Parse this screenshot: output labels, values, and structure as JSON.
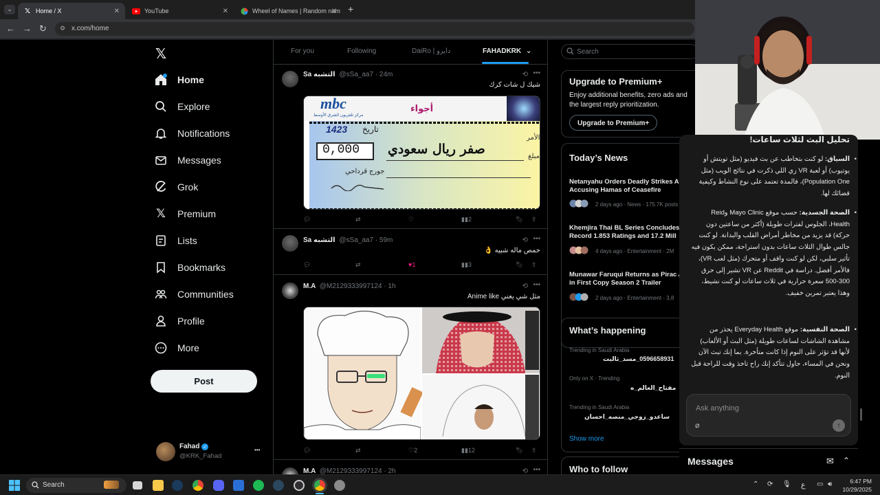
{
  "browser": {
    "tabs": [
      {
        "title": "Home / X"
      },
      {
        "title": "YouTube"
      },
      {
        "title": "Wheel of Names | Random nam"
      }
    ],
    "new_tab": "+",
    "url": "x.com/home"
  },
  "sidebar": {
    "items": [
      {
        "label": "Home",
        "icon": "home-icon"
      },
      {
        "label": "Explore",
        "icon": "search-icon"
      },
      {
        "label": "Notifications",
        "icon": "bell-icon"
      },
      {
        "label": "Messages",
        "icon": "mail-icon"
      },
      {
        "label": "Grok",
        "icon": "grok-icon"
      },
      {
        "label": "Premium",
        "icon": "x-logo-icon"
      },
      {
        "label": "Lists",
        "icon": "list-icon"
      },
      {
        "label": "Bookmarks",
        "icon": "bookmark-icon"
      },
      {
        "label": "Communities",
        "icon": "communities-icon"
      },
      {
        "label": "Profile",
        "icon": "person-icon"
      },
      {
        "label": "More",
        "icon": "more-circle-icon"
      }
    ],
    "post_label": "Post",
    "account": {
      "name": "Fahad",
      "handle": "@KRK_Fahad",
      "more": "•••"
    }
  },
  "timeline": {
    "tabs": [
      {
        "label": "For you"
      },
      {
        "label": "Following"
      },
      {
        "label": "DaiRo | دايرو"
      },
      {
        "label": "FAHADKRK"
      }
    ],
    "tweets": [
      {
        "name": "Sa التشبه",
        "handle": "@sSa_aa7 · 24m",
        "text": "شيك ل شات كرك",
        "media": {
          "brand": "mbc",
          "brand_sub": "مركز تلفزيون الشرق الأوسط",
          "ajwa": "أجواء",
          "date_label": "تاريخ",
          "date": "1423",
          "amount": "0,000",
          "words": "صفر ريال سعودي",
          "signer": "جورج قرداحي",
          "order_label": "الأمر",
          "amount_label": "مبلغ"
        },
        "replies": "",
        "retweets": "",
        "likes": "",
        "views": "2"
      },
      {
        "name": "Sa التشبه",
        "handle": "@sSa_aa7 · 59m",
        "text": "حمص ماله شبيه 👌",
        "replies": "",
        "retweets": "",
        "likes": "1",
        "views": "3"
      },
      {
        "name": "M.A",
        "handle": "@M2129333997124 · 1h",
        "text": "مثل شي يعني Anime like",
        "replies": "",
        "retweets": "",
        "likes": "2",
        "views": "12"
      },
      {
        "name": "M.A",
        "handle": "@M2129333997124 · 2h",
        "text": ""
      }
    ]
  },
  "right": {
    "search_placeholder": "Search",
    "premium": {
      "title": "Upgrade to Premium+",
      "desc": "Enjoy additional benefits, zero ads and the largest reply prioritization.",
      "button": "Upgrade to Premium+"
    },
    "news": {
      "title": "Today’s News",
      "items": [
        {
          "title": "Netanyahu Orders Deadly Strikes After Accusing Hamas of Ceasefire",
          "meta": "2 days ago · News · 175.7K posts"
        },
        {
          "title": "Khemjira Thai BL Series Concludes Record 1.853 Ratings and 17.2 Mill",
          "meta": "4 days ago · Entertainment · 2M"
        },
        {
          "title": "Munawar Faruqui Returns as Pirac Arif in First Copy Season 2 Trailer",
          "meta": "2 days ago · Entertainment · 3,8"
        }
      ]
    },
    "happening": {
      "title": "What’s happening",
      "items": [
        {
          "category": "Trending in Saudi Arabia",
          "name": "0596658931_مسد_ثالبت"
        },
        {
          "category": "Only on X · Trending",
          "name": "مفتاح_العالم_ه"
        },
        {
          "category": "Trending in Saudi Arabia",
          "name": "ساعدو_زوجي_منصه_احسان"
        }
      ],
      "show_more": "Show more"
    },
    "who_to_follow": "Who to follow"
  },
  "chat": {
    "heading": "تحليل البث لثلاث ساعات!",
    "bullets": [
      {
        "label": "السياق:",
        "text": "لو كنت بتخاطب عن بث فيديو (مثل تويتش أو يوتيوب) أو لعبة VR زي اللي ذكرت في نتائج الويب (مثل Population One)، فالمدة تعتمد على نوع النشاط وكيفية قضائك لها."
      },
      {
        "label": "الصحة الجسدية:",
        "text": "حسب موقع Mayo Clinic وReid Health، الجلوس لفترات طويلة (أكثر من ساعتين دون حركة) قد يزيد من مخاطر أمراض القلب والبدانة. لو كنت جالس طوال الثلاث ساعات بدون استراحة، ممكن يكون فيه تأثير سلبي، لكن لو كنت واقف أو متحرك (مثل لعب VR)، فالأمر أفضل. دراسة في Reddit عن VR تشير إلى حرق 300-500 سعرة حرارية في ثلاث ساعات لو كنت نشيط، وهذا يعتبر تمرين خفيف."
      },
      {
        "label": "الصحة النفسية:",
        "text": "موقع Everyday Health يحذر من مشاهدة الشاشات لساعات طويلة (مثل البث أو الألعاب) لأنها قد تؤثر على النوم إذا كانت متأخرة. بما إنك تبث الآن ونحن في المساء، حاول تتأكد إنك راح تاخذ وقت للراحة قبل النوم."
      }
    ],
    "input_placeholder": "Ask anything",
    "messages_title": "Messages"
  },
  "taskbar": {
    "search": "Search",
    "lang": "ع",
    "time": "6:47 PM",
    "date": "10/29/2025"
  },
  "colors": {
    "accent": "#1d9bf0",
    "like": "#f91880",
    "bg": "#000000",
    "border": "#2f3336",
    "muted": "#71767b"
  }
}
